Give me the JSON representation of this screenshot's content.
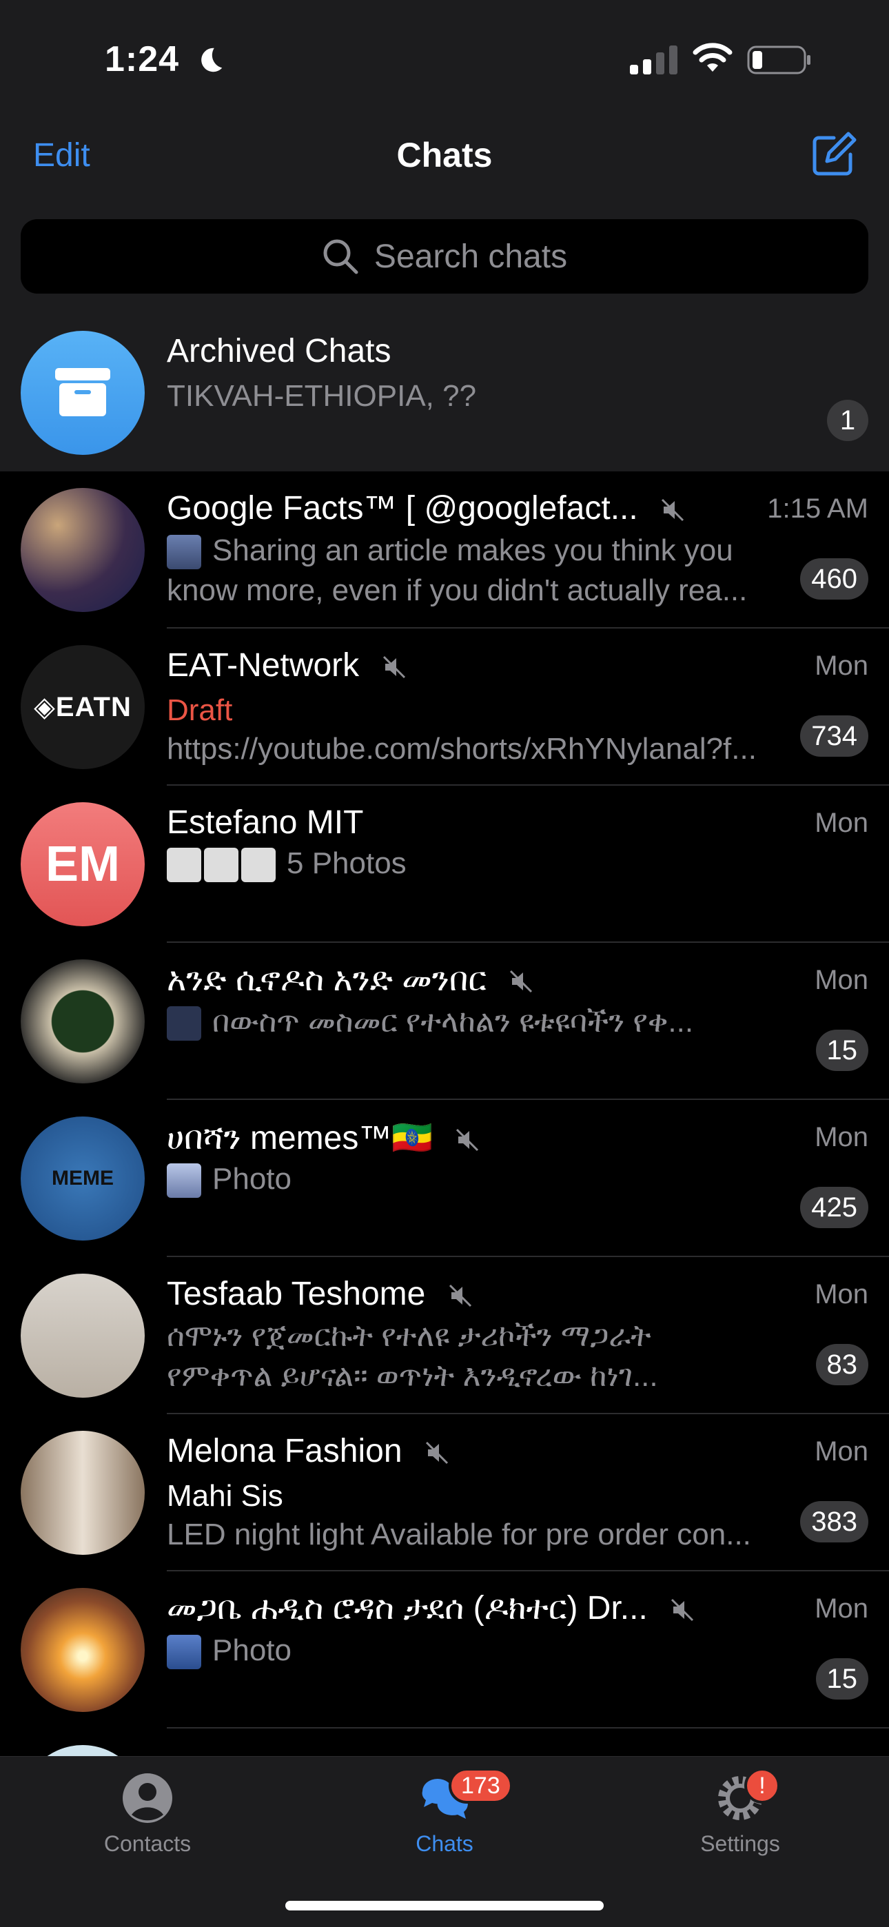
{
  "status": {
    "time": "1:24"
  },
  "nav": {
    "edit": "Edit",
    "title": "Chats"
  },
  "search": {
    "placeholder": "Search chats"
  },
  "archived": {
    "title": "Archived Chats",
    "subtitle": "TIKVAH-ETHIOPIA, ??",
    "badge": "1"
  },
  "chats": [
    {
      "name": "Google Facts™ [      @googlefact...",
      "time": "1:15 AM",
      "line1": "Sharing an article makes you think you",
      "line2": "know more, even if you didn't actually rea...",
      "badge": "460"
    },
    {
      "name": "EAT-Network",
      "time": "Mon",
      "draft": "Draft",
      "line2": "https://youtube.com/shorts/xRhYNylanal?f...",
      "badge": "734"
    },
    {
      "name": "Estefano MIT",
      "initials": "EM",
      "time": "Mon",
      "line1": "5 Photos"
    },
    {
      "name": "አንድ ሲኖዶስ አንድ መንበር",
      "time": "Mon",
      "line1": "በውስጥ መስመር የተላከልን ዩቱዩባችን የቀ...",
      "badge": "15"
    },
    {
      "name": "ሀበሻን memes™🇪🇹",
      "time": "Mon",
      "line1": "Photo",
      "badge": "425"
    },
    {
      "name": "Tesfaab Teshome",
      "time": "Mon",
      "line1": "ሰሞኑን የጀመርኩት የተለዩ ታሪኮችን ማጋራት",
      "line2": "የምቀጥል ይሆናል። ወጥነት እንዲኖረው ከነገ...",
      "badge": "83"
    },
    {
      "name": "Melona Fashion",
      "time": "Mon",
      "line1": "Mahi Sis",
      "line2": "LED night light Available for pre order con...",
      "badge": "383"
    },
    {
      "name": "መጋቤ ሐዲስ ሮዳስ ታደሰ (ዶክተር) Dr...",
      "time": "Mon",
      "line1": "Photo",
      "badge": "15"
    }
  ],
  "tabs": {
    "contacts": "Contacts",
    "chats": "Chats",
    "chats_badge": "173",
    "settings": "Settings",
    "settings_badge": "!"
  },
  "colors": {
    "accent": "#3e8ef0",
    "draft": "#eb5545",
    "badge": "#3a3a3c"
  }
}
